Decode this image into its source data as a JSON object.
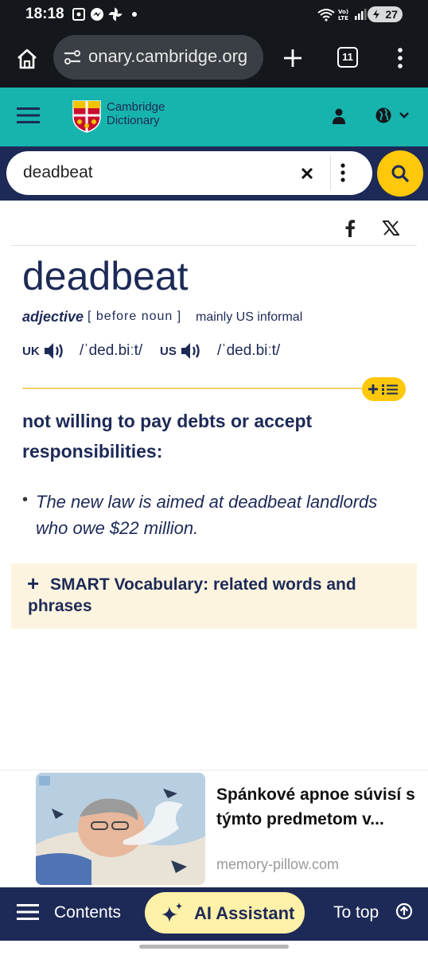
{
  "status_bar": {
    "time": "18:18",
    "battery": "27"
  },
  "browser": {
    "url": "onary.cambridge.org",
    "tab_count": "11"
  },
  "header": {
    "brand_line1": "Cambridge",
    "brand_line2": "Dictionary"
  },
  "search": {
    "value": "deadbeat"
  },
  "entry": {
    "headword": "deadbeat",
    "part_of_speech": "adjective",
    "grammar": "[ before noun ]",
    "usage": "mainly US informal",
    "uk_label": "UK",
    "uk_ipa": "/ˈded.biːt/",
    "us_label": "US",
    "us_ipa": "/ˈded.biːt/",
    "definition": "not willing to pay debts or accept responsibilities:",
    "example": "The new law is aimed at deadbeat landlords who owe $22 million.",
    "smart_vocab": "SMART Vocabulary: related words and phrases"
  },
  "ad": {
    "title": "Spánkové apnoe súvisí s týmto predmetom v...",
    "domain": "memory-pillow.com"
  },
  "bottom_nav": {
    "contents": "Contents",
    "ai_assistant": "AI Assistant",
    "to_top": "To top"
  },
  "colors": {
    "teal_header": "#17b3ad",
    "navy": "#1d2a57",
    "yellow": "#ffc80a",
    "smart_bg": "#fdf4df"
  }
}
